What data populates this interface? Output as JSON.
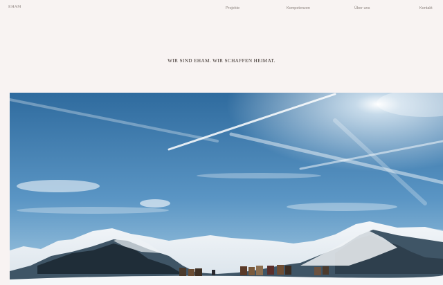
{
  "header": {
    "logo_text": "EHAM",
    "nav": [
      {
        "label": "Projekte"
      },
      {
        "label": "Kompetenzen"
      },
      {
        "label": "Über uns"
      },
      {
        "label": "Kontakt"
      }
    ]
  },
  "main": {
    "headline": "WIR SIND EHAM. WIR SCHAFFEN HEIMAT."
  },
  "colors": {
    "background": "#f8f3f2",
    "sky_top": "#2f6b9e",
    "sky_bottom": "#a9cde3"
  }
}
